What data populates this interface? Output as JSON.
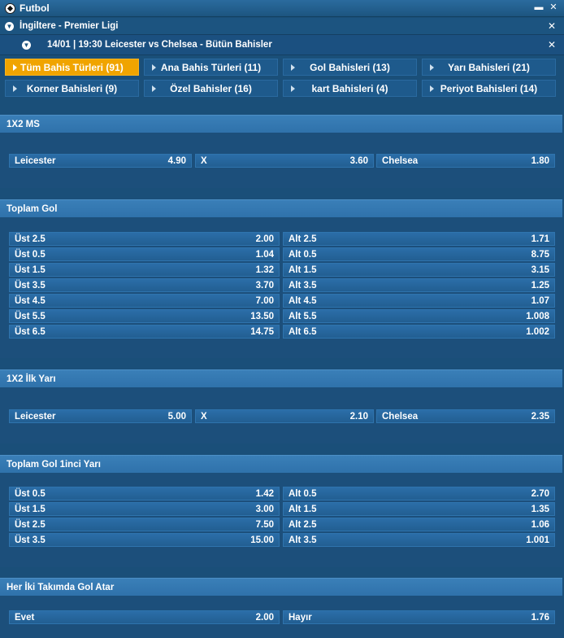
{
  "topbar": {
    "title": "Futbol",
    "minimize": "▬",
    "close": "✕"
  },
  "league": {
    "name": "İngiltere - Premier Ligi",
    "close": "✕"
  },
  "event": {
    "text": "14/01 | 19:30 Leicester vs Chelsea - Bütün Bahisler",
    "close": "✕"
  },
  "tabs": [
    "Tüm Bahis Türleri (91)",
    "Ana Bahis Türleri (11)",
    "Gol Bahisleri (13)",
    "Yarı Bahisleri (21)",
    "Korner Bahisleri (9)",
    "Özel Bahisler (16)",
    "kart Bahisleri (4)",
    "Periyot Bahisleri (14)"
  ],
  "sections": {
    "ms1x2": {
      "title": "1X2 MS",
      "row": [
        {
          "name": "Leicester",
          "odd": "4.90"
        },
        {
          "name": "X",
          "odd": "3.60"
        },
        {
          "name": "Chelsea",
          "odd": "1.80"
        }
      ]
    },
    "toplam_gol": {
      "title": "Toplam Gol",
      "rows": [
        {
          "over": "Üst 2.5",
          "over_odd": "2.00",
          "under": "Alt 2.5",
          "under_odd": "1.71"
        },
        {
          "over": "Üst 0.5",
          "over_odd": "1.04",
          "under": "Alt 0.5",
          "under_odd": "8.75"
        },
        {
          "over": "Üst 1.5",
          "over_odd": "1.32",
          "under": "Alt 1.5",
          "under_odd": "3.15"
        },
        {
          "over": "Üst 3.5",
          "over_odd": "3.70",
          "under": "Alt 3.5",
          "under_odd": "1.25"
        },
        {
          "over": "Üst 4.5",
          "over_odd": "7.00",
          "under": "Alt 4.5",
          "under_odd": "1.07"
        },
        {
          "over": "Üst 5.5",
          "over_odd": "13.50",
          "under": "Alt 5.5",
          "under_odd": "1.008"
        },
        {
          "over": "Üst 6.5",
          "over_odd": "14.75",
          "under": "Alt 6.5",
          "under_odd": "1.002"
        }
      ]
    },
    "ilk_yari": {
      "title": "1X2 İlk Yarı",
      "row": [
        {
          "name": "Leicester",
          "odd": "5.00"
        },
        {
          "name": "X",
          "odd": "2.10"
        },
        {
          "name": "Chelsea",
          "odd": "2.35"
        }
      ]
    },
    "toplam_gol_1": {
      "title": "Toplam Gol 1inci Yarı",
      "rows": [
        {
          "over": "Üst 0.5",
          "over_odd": "1.42",
          "under": "Alt 0.5",
          "under_odd": "2.70"
        },
        {
          "over": "Üst 1.5",
          "over_odd": "3.00",
          "under": "Alt 1.5",
          "under_odd": "1.35"
        },
        {
          "over": "Üst 2.5",
          "over_odd": "7.50",
          "under": "Alt 2.5",
          "under_odd": "1.06"
        },
        {
          "over": "Üst 3.5",
          "over_odd": "15.00",
          "under": "Alt 3.5",
          "under_odd": "1.001"
        }
      ]
    },
    "kg": {
      "title": "Her İki Takımda Gol Atar",
      "row": [
        {
          "name": "Evet",
          "odd": "2.00"
        },
        {
          "name": "Hayır",
          "odd": "1.76"
        }
      ]
    }
  }
}
